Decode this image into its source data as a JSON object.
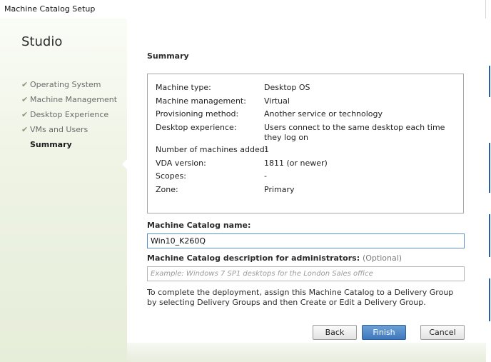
{
  "window": {
    "title": "Machine Catalog Setup"
  },
  "sidebar": {
    "app_name": "Studio",
    "steps": [
      {
        "label": "Operating System",
        "completed": true
      },
      {
        "label": "Machine Management",
        "completed": true
      },
      {
        "label": "Desktop Experience",
        "completed": true
      },
      {
        "label": "VMs and Users",
        "completed": true
      },
      {
        "label": "Summary",
        "completed": false,
        "active": true
      }
    ],
    "check_glyph": "✔"
  },
  "main": {
    "title": "Summary",
    "summary": [
      {
        "label": "Machine type:",
        "value": "Desktop OS"
      },
      {
        "label": "Machine management:",
        "value": "Virtual"
      },
      {
        "label": "Provisioning method:",
        "value": "Another service or technology"
      },
      {
        "label": "Desktop experience:",
        "value": "Users connect to the same desktop each time they log on"
      },
      {
        "label": "Number of machines added:",
        "value": "1"
      },
      {
        "label": "VDA version:",
        "value": "1811 (or newer)"
      },
      {
        "label": "Scopes:",
        "value": "-"
      },
      {
        "label": "Zone:",
        "value": "Primary"
      }
    ],
    "catalog_name_label": "Machine Catalog name:",
    "catalog_name_value": "Win10_K260Q",
    "description_label": "Machine Catalog description for administrators:",
    "description_optional": "(Optional)",
    "description_placeholder": "Example: Windows 7 SP1 desktops for the London Sales office",
    "description_value": "",
    "note": "To complete the deployment, assign this Machine Catalog to a Delivery Group by selecting Delivery Groups and then Create or Edit a Delivery Group."
  },
  "buttons": {
    "back": "Back",
    "finish": "Finish",
    "cancel": "Cancel"
  },
  "colors": {
    "accent": "#3f78bd",
    "sidebar_bg": "#eef3e4",
    "check": "#8a9a78"
  }
}
